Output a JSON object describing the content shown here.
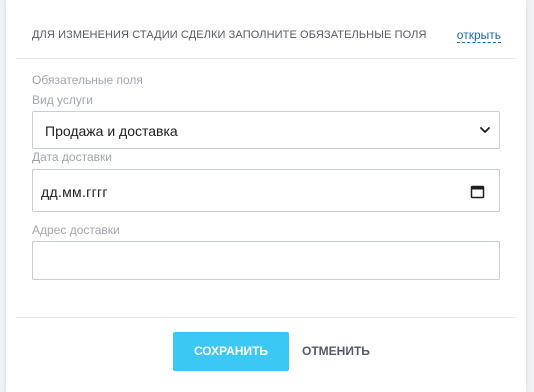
{
  "header": {
    "title": "ДЛЯ ИЗМЕНЕНИЯ СТАДИИ СДЕЛКИ ЗАПОЛНИТЕ ОБЯЗАТЕЛЬНЫЕ ПОЛЯ",
    "open_link": "открыть"
  },
  "form": {
    "section_title": "Обязательные поля",
    "service_type": {
      "label": "Вид услуги",
      "value": "Продажа и доставка"
    },
    "delivery_date": {
      "label": "Дата доставки",
      "placeholder": "дд.мм.гггг"
    },
    "delivery_address": {
      "label": "Адрес доставки",
      "value": ""
    }
  },
  "footer": {
    "save_label": "СОХРАНИТЬ",
    "cancel_label": "ОТМЕНИТЬ"
  },
  "colors": {
    "save_button": "#3bc8f5",
    "link": "#2067b0",
    "label": "#a2a7ad"
  }
}
